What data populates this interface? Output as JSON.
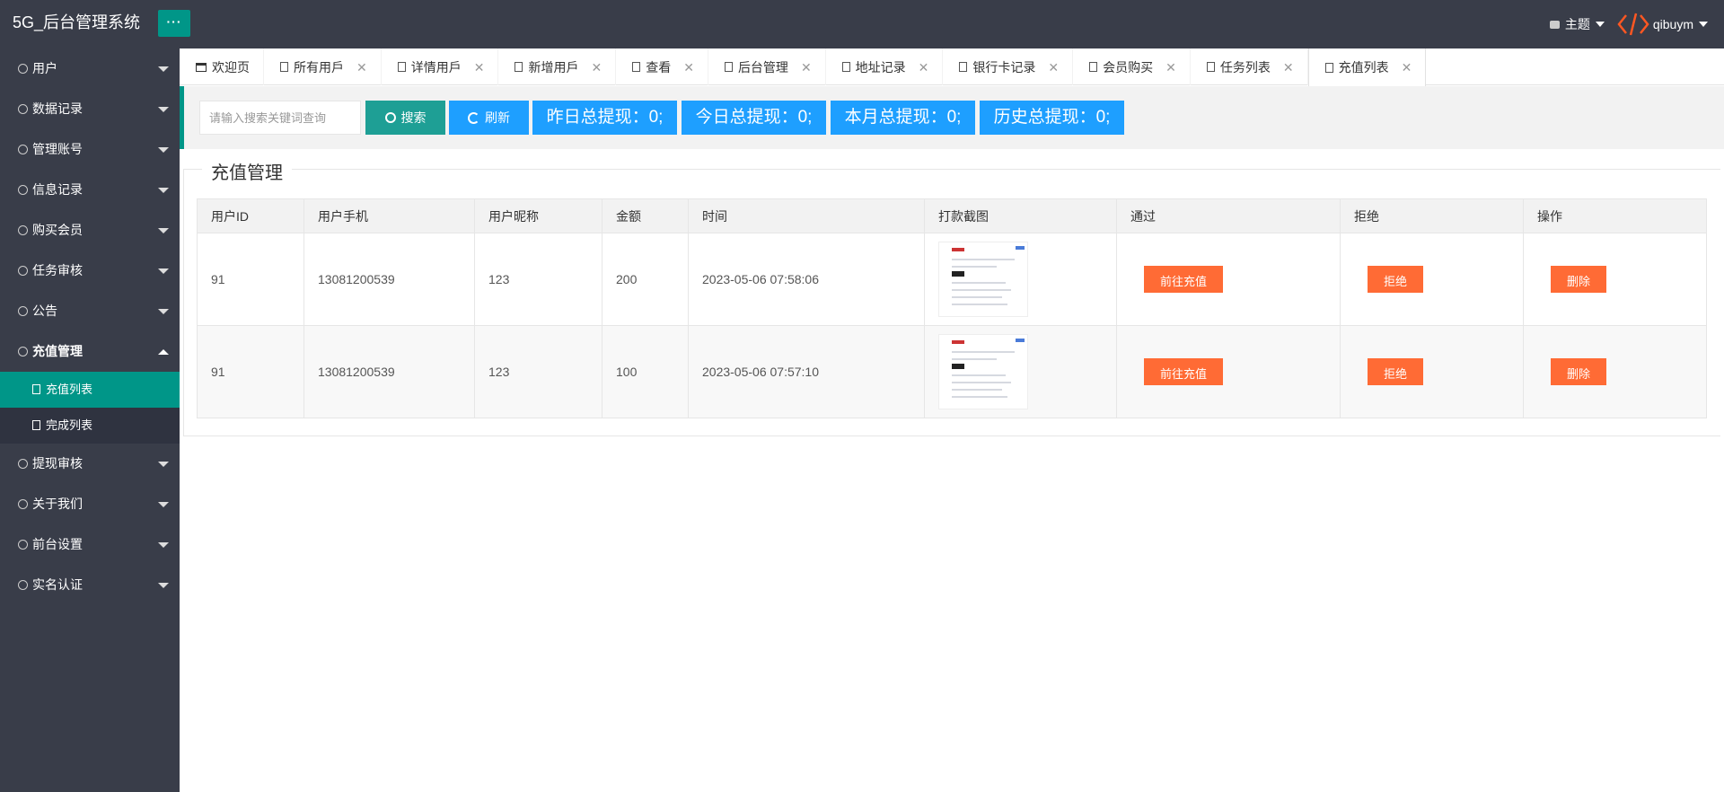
{
  "app": {
    "title": "5G_后台管理系统",
    "menu_toggle": "···"
  },
  "header": {
    "theme_label": "主题",
    "user_name": "qibuym"
  },
  "sidebar": {
    "items": [
      {
        "label": "用户"
      },
      {
        "label": "数据记录"
      },
      {
        "label": "管理账号"
      },
      {
        "label": "信息记录"
      },
      {
        "label": "购买会员"
      },
      {
        "label": "任务审核"
      },
      {
        "label": "公告"
      },
      {
        "label": "充值管理",
        "sub": [
          {
            "label": "充值列表"
          },
          {
            "label": "完成列表"
          }
        ]
      },
      {
        "label": "提现审核"
      },
      {
        "label": "关于我们"
      },
      {
        "label": "前台设置"
      },
      {
        "label": "实名认证"
      }
    ]
  },
  "tabs": [
    {
      "label": "欢迎页"
    },
    {
      "label": "所有用戶"
    },
    {
      "label": "详情用戶"
    },
    {
      "label": "新增用戶"
    },
    {
      "label": "查看"
    },
    {
      "label": "后台管理"
    },
    {
      "label": "地址记录"
    },
    {
      "label": "银行卡记录"
    },
    {
      "label": "会员购买"
    },
    {
      "label": "任务列表"
    },
    {
      "label": "充值列表"
    }
  ],
  "toolbar": {
    "search_placeholder": "请输入搜索关键词查询",
    "search_label": "搜索",
    "refresh_label": "刷新",
    "stats": [
      {
        "label": "昨日总提现：0;"
      },
      {
        "label": "今日总提现：0;"
      },
      {
        "label": "本月总提现：0;"
      },
      {
        "label": "历史总提现：0;"
      }
    ]
  },
  "panel": {
    "legend": "充值管理"
  },
  "table": {
    "headers": [
      "用户ID",
      "用户手机",
      "用户昵称",
      "金额",
      "时间",
      "打款截图",
      "通过",
      "拒绝",
      "操作"
    ],
    "rows": [
      {
        "id": "91",
        "phone": "13081200539",
        "nick": "123",
        "amount": "200",
        "time": "2023-05-06 07:58:06"
      },
      {
        "id": "91",
        "phone": "13081200539",
        "nick": "123",
        "amount": "100",
        "time": "2023-05-06 07:57:10"
      }
    ],
    "approve_label": "前往充值",
    "reject_label": "拒绝",
    "delete_label": "删除"
  },
  "colors": {
    "sidebar_bg": "#393d49",
    "accent": "#009688",
    "blue": "#1e9fff",
    "orange": "#ff6b35"
  }
}
